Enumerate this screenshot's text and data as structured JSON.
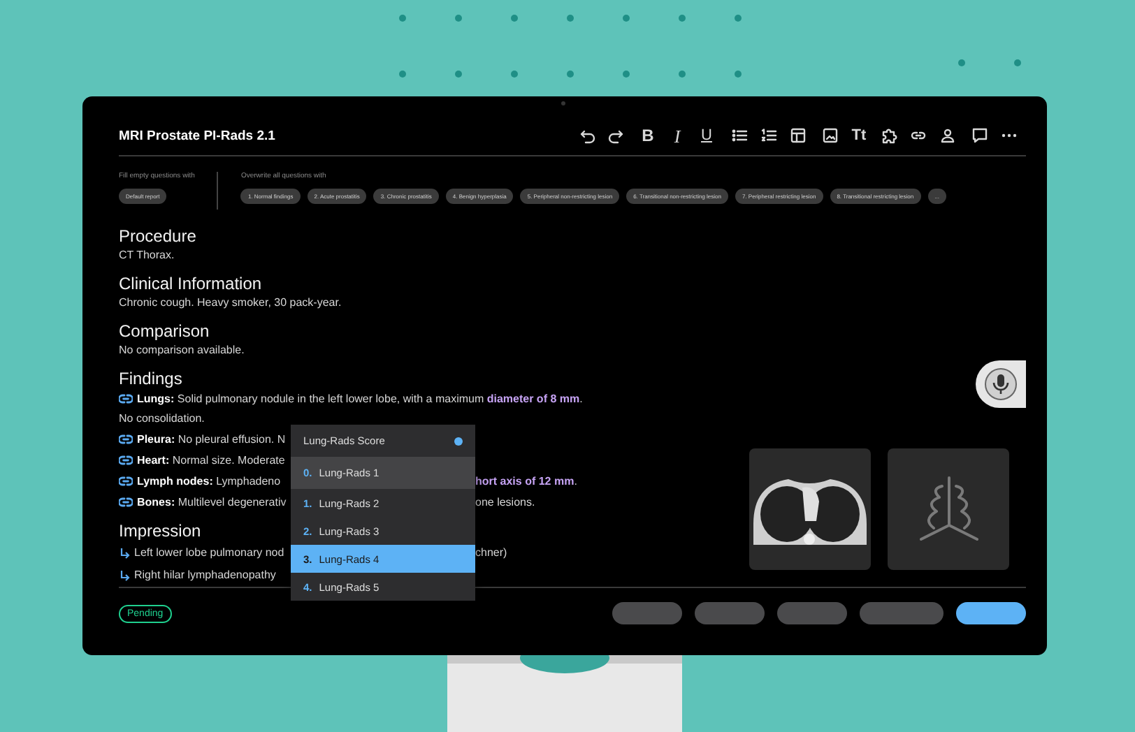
{
  "document": {
    "title": "MRI Prostate PI-Rads 2.1"
  },
  "toolbar": {
    "groups": [
      {
        "items": [
          {
            "kind": "undo"
          },
          {
            "kind": "redo"
          }
        ]
      },
      {
        "items": [
          {
            "kind": "bold",
            "label": "B"
          },
          {
            "kind": "italic",
            "label": "I"
          },
          {
            "kind": "underline",
            "label": "U"
          }
        ]
      },
      {
        "items": [
          {
            "kind": "bullets"
          },
          {
            "kind": "numbers"
          },
          {
            "kind": "table"
          }
        ]
      },
      {
        "items": [
          {
            "kind": "image"
          },
          {
            "kind": "textsize",
            "label": "Tt"
          },
          {
            "kind": "puzzle"
          },
          {
            "kind": "link"
          },
          {
            "kind": "person"
          }
        ]
      },
      {
        "items": [
          {
            "kind": "comment"
          },
          {
            "kind": "more"
          }
        ]
      }
    ]
  },
  "fill_empty": {
    "label": "Fill empty questions with",
    "chips": [
      "Default report"
    ]
  },
  "overwrite_all": {
    "label": "Overwrite all questions with",
    "chips": [
      "1. Normal findings",
      "2. Acute prostatitis",
      "3. Chronic prostatitis",
      "4. Benign hyperplasia",
      "5. Peripheral non-restricting lesion",
      "6. Transitional non-restricting lesion",
      "7. Peripheral restricting lesion",
      "8. Transitional restricting lesion",
      "..."
    ]
  },
  "sections": [
    {
      "heading": "Procedure",
      "lines": [
        {
          "kind": "plain",
          "parts": [
            {
              "text": "CT Thorax."
            }
          ]
        }
      ]
    },
    {
      "heading": "Clinical Information",
      "lines": [
        {
          "kind": "plain",
          "parts": [
            {
              "text": "Chronic cough. Heavy smoker, 30 pack-year."
            }
          ]
        }
      ]
    },
    {
      "heading": "Comparison",
      "lines": [
        {
          "kind": "plain",
          "parts": [
            {
              "text": "No comparison available."
            }
          ]
        }
      ]
    },
    {
      "heading": "Findings",
      "lines": [
        {
          "kind": "finding",
          "label": "Lungs:",
          "parts": [
            {
              "text": "Solid pulmonary nodule in the left lower lobe, with a maximum "
            },
            {
              "text": "diameter of 8 mm",
              "highlight": true
            },
            {
              "text": "."
            }
          ]
        },
        {
          "kind": "plain",
          "parts": [
            {
              "text": "No consolidation."
            }
          ]
        },
        {
          "kind": "finding",
          "label": "Pleura:",
          "parts": [
            {
              "text": "No pleural effusion. N"
            }
          ]
        },
        {
          "kind": "finding",
          "label": "Heart:",
          "parts": [
            {
              "text": "Normal size. Moderate"
            }
          ]
        },
        {
          "kind": "finding",
          "label": "Lymph nodes:",
          "parts": [
            {
              "text": "Lymphadeno"
            }
          ],
          "right_parts": [
            {
              "text": "hort axis of 12 mm",
              "highlight": true
            },
            {
              "text": "."
            }
          ]
        },
        {
          "kind": "finding",
          "label": "Bones:",
          "parts": [
            {
              "text": "Multilevel degenerativ"
            }
          ],
          "right_parts": [
            {
              "text": "one lesions."
            }
          ]
        }
      ]
    },
    {
      "heading": "Impression",
      "lines": [
        {
          "kind": "arrow",
          "parts": [
            {
              "text": "Left lower lobe pulmonary nod"
            }
          ],
          "right_parts": [
            {
              "text": "chner)"
            }
          ]
        },
        {
          "kind": "arrow",
          "parts": [
            {
              "text": "Right hilar lymphadenopathy"
            }
          ]
        }
      ]
    }
  ],
  "dropdown": {
    "title": "Lung-Rads Score",
    "items": [
      {
        "number": "0.",
        "label": "Lung-Rads 1",
        "selected": false,
        "highlighted": true
      },
      {
        "number": "1.",
        "label": "Lung-Rads 2",
        "selected": false,
        "highlighted": false
      },
      {
        "number": "2.",
        "label": "Lung-Rads 3",
        "selected": false,
        "highlighted": false
      },
      {
        "number": "3.",
        "label": "Lung-Rads 4",
        "selected": true,
        "highlighted": false
      },
      {
        "number": "4.",
        "label": "Lung-Rads 5",
        "selected": false,
        "highlighted": false
      }
    ]
  },
  "images": [
    {
      "kind": "ct-scan"
    },
    {
      "kind": "lungs"
    }
  ],
  "status": {
    "label": "Pending"
  },
  "footer_buttons": [
    {
      "kind": "secondary"
    },
    {
      "kind": "secondary"
    },
    {
      "kind": "secondary"
    },
    {
      "kind": "wide"
    },
    {
      "kind": "primary"
    }
  ]
}
